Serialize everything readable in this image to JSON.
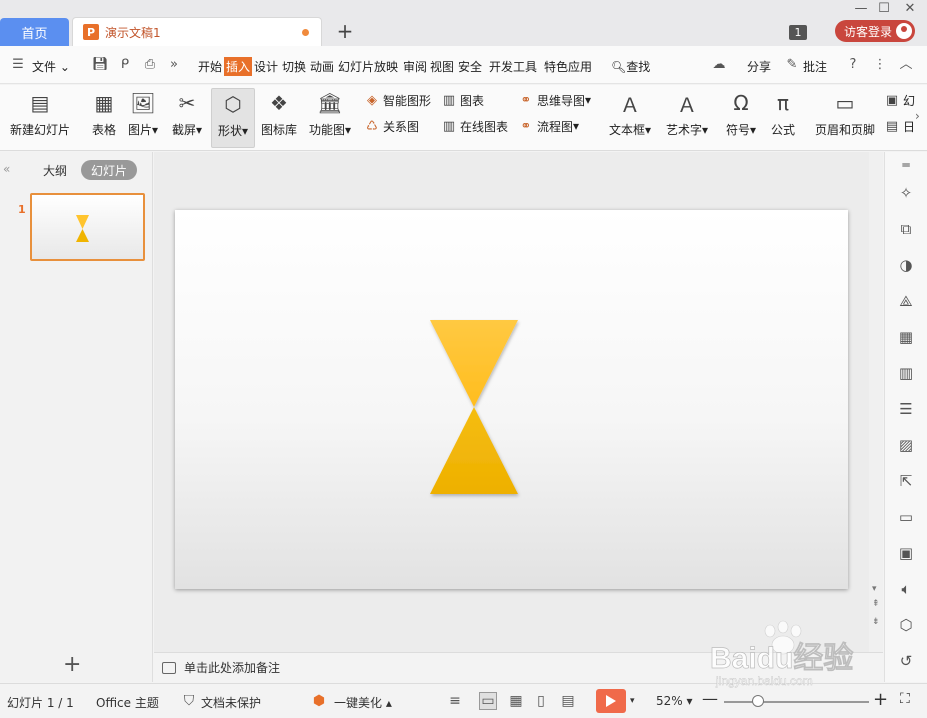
{
  "tabs": {
    "home": "首页",
    "document": "演示文稿1",
    "window_count": "1",
    "login": "访客登录"
  },
  "menu": {
    "file": "文件",
    "items": [
      "开始",
      "插入",
      "设计",
      "切换",
      "动画",
      "幻灯片放映",
      "审阅",
      "视图",
      "安全",
      "开发工具",
      "特色应用"
    ],
    "active": "插入",
    "search": "查找",
    "share": "分享",
    "comment": "批注"
  },
  "ribbon": {
    "new_slide": "新建幻灯片",
    "table": "表格",
    "picture": "图片",
    "screenshot": "截屏",
    "shape": "形状",
    "icon_lib": "图标库",
    "function_chart": "功能图",
    "smart_art": "智能图形",
    "relation_chart": "关系图",
    "chart": "图表",
    "online_chart": "在线图表",
    "mind_map": "思维导图",
    "flow_chart": "流程图",
    "text_box": "文本框",
    "word_art": "艺术字",
    "symbol": "符号",
    "formula": "公式",
    "header_footer": "页眉和页脚",
    "cut_right_1": "幻",
    "cut_right_2": "日"
  },
  "left_panel": {
    "outline_tab": "大纲",
    "slides_tab": "幻灯片",
    "slide_number": "1"
  },
  "slide": {
    "shape_color_top": "#ffc42e",
    "shape_color_bottom": "#f0b400"
  },
  "notes": {
    "placeholder": "单击此处添加备注"
  },
  "status": {
    "slide_count": "幻灯片 1 / 1",
    "theme": "Office 主题",
    "protection": "文档未保护",
    "beautify": "一键美化",
    "zoom": "52%"
  },
  "watermark": {
    "brand": "Baidu经验",
    "url": "jingyan.baidu.com"
  },
  "colors": {
    "accent": "#e8702a",
    "home_tab": "#5b8ff0",
    "login": "#c9463d",
    "play": "#f06a4a"
  }
}
